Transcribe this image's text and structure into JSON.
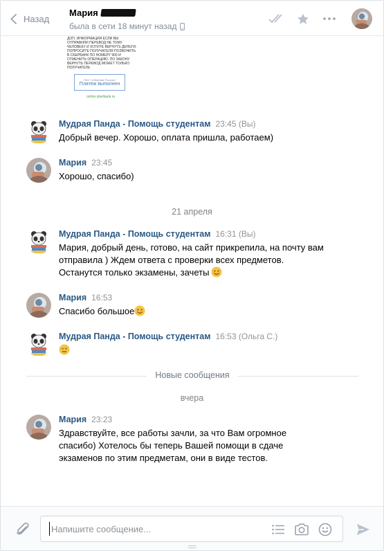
{
  "header": {
    "back_label": "Назад",
    "peer_name": "Мария",
    "peer_status": "была в сети 18 минут назад"
  },
  "receipt": {
    "text": "ДОП. ИНФОРМАЦИЯ ЕСЛИ ВЫ ОТПРАВИЛИ ПЕРЕВОД НЕ ТОМУ ЧЕЛОВЕКУ И ХОТИТЕ ВЕРНУТЬ ДЕНЬГИ, ПОПРОСИТЕ ПОЛУЧАТЕЛЯ ПОЗВОНИТЬ В СБЕРБАНК ПО НОМЕРУ 900 И ОТМЕНИТЬ ОПЕРАЦИЮ. ПО ЗАКОНУ ВЕРНУТЬ ПЕРЕВОД МОЖЕТ ТОЛЬКО ПОЛУЧАТЕЛЬ",
    "stamp_small": "ПАО «Сбербанк России»",
    "stamp_label": "Платеж выполнен",
    "link": "online.sberbank.ru"
  },
  "messages": [
    {
      "author": "Мудрая Панда - Помощь студентам",
      "time": "23:45 (Вы)",
      "lines": [
        "Добрый вечер. Хорошо, оплата пришла, работаем)"
      ]
    },
    {
      "author": "Мария",
      "time": "23:45",
      "lines": [
        "Хорошо, спасибо)"
      ]
    },
    {
      "author": "Мудрая Панда - Помощь студентам",
      "time": "16:31 (Вы)",
      "lines": [
        "Мария, добрый день, готово, на сайт прикрепила, на почту вам",
        "отправила ) Ждем ответа с проверки всех предметов.",
        "Останутся только экзамены, зачеты"
      ]
    },
    {
      "author": "Мария",
      "time": "16:53",
      "lines": [
        "Спасибо большое"
      ]
    },
    {
      "author": "Мудрая Панда - Помощь студентам",
      "time": "16:53 (Ольга С.)",
      "lines": [
        ""
      ]
    },
    {
      "author": "Мария",
      "time": "23:23",
      "lines": [
        "Здравствуйте, все работы зачли, за что Вам огромное",
        "спасибо) Хотелось бы теперь Вашей помощи в сдаче",
        "экзаменов по этим предметам, они в виде тестов."
      ]
    }
  ],
  "separators": {
    "date_1": "21 апреля",
    "new_messages": "Новые сообщения",
    "date_2": "вчера"
  },
  "composer": {
    "placeholder": "Напишите сообщение..."
  },
  "icons": {
    "back": "chevron-left-icon",
    "phone": "phone-icon",
    "read": "double-check-icon",
    "star": "star-icon",
    "more": "more-icon",
    "attach": "paperclip-icon",
    "templates": "list-icon",
    "camera": "camera-icon",
    "emoji": "smile-icon",
    "send": "send-icon"
  },
  "colors": {
    "link": "#2a5885",
    "muted": "#939393",
    "emoji": "#f6c244"
  }
}
